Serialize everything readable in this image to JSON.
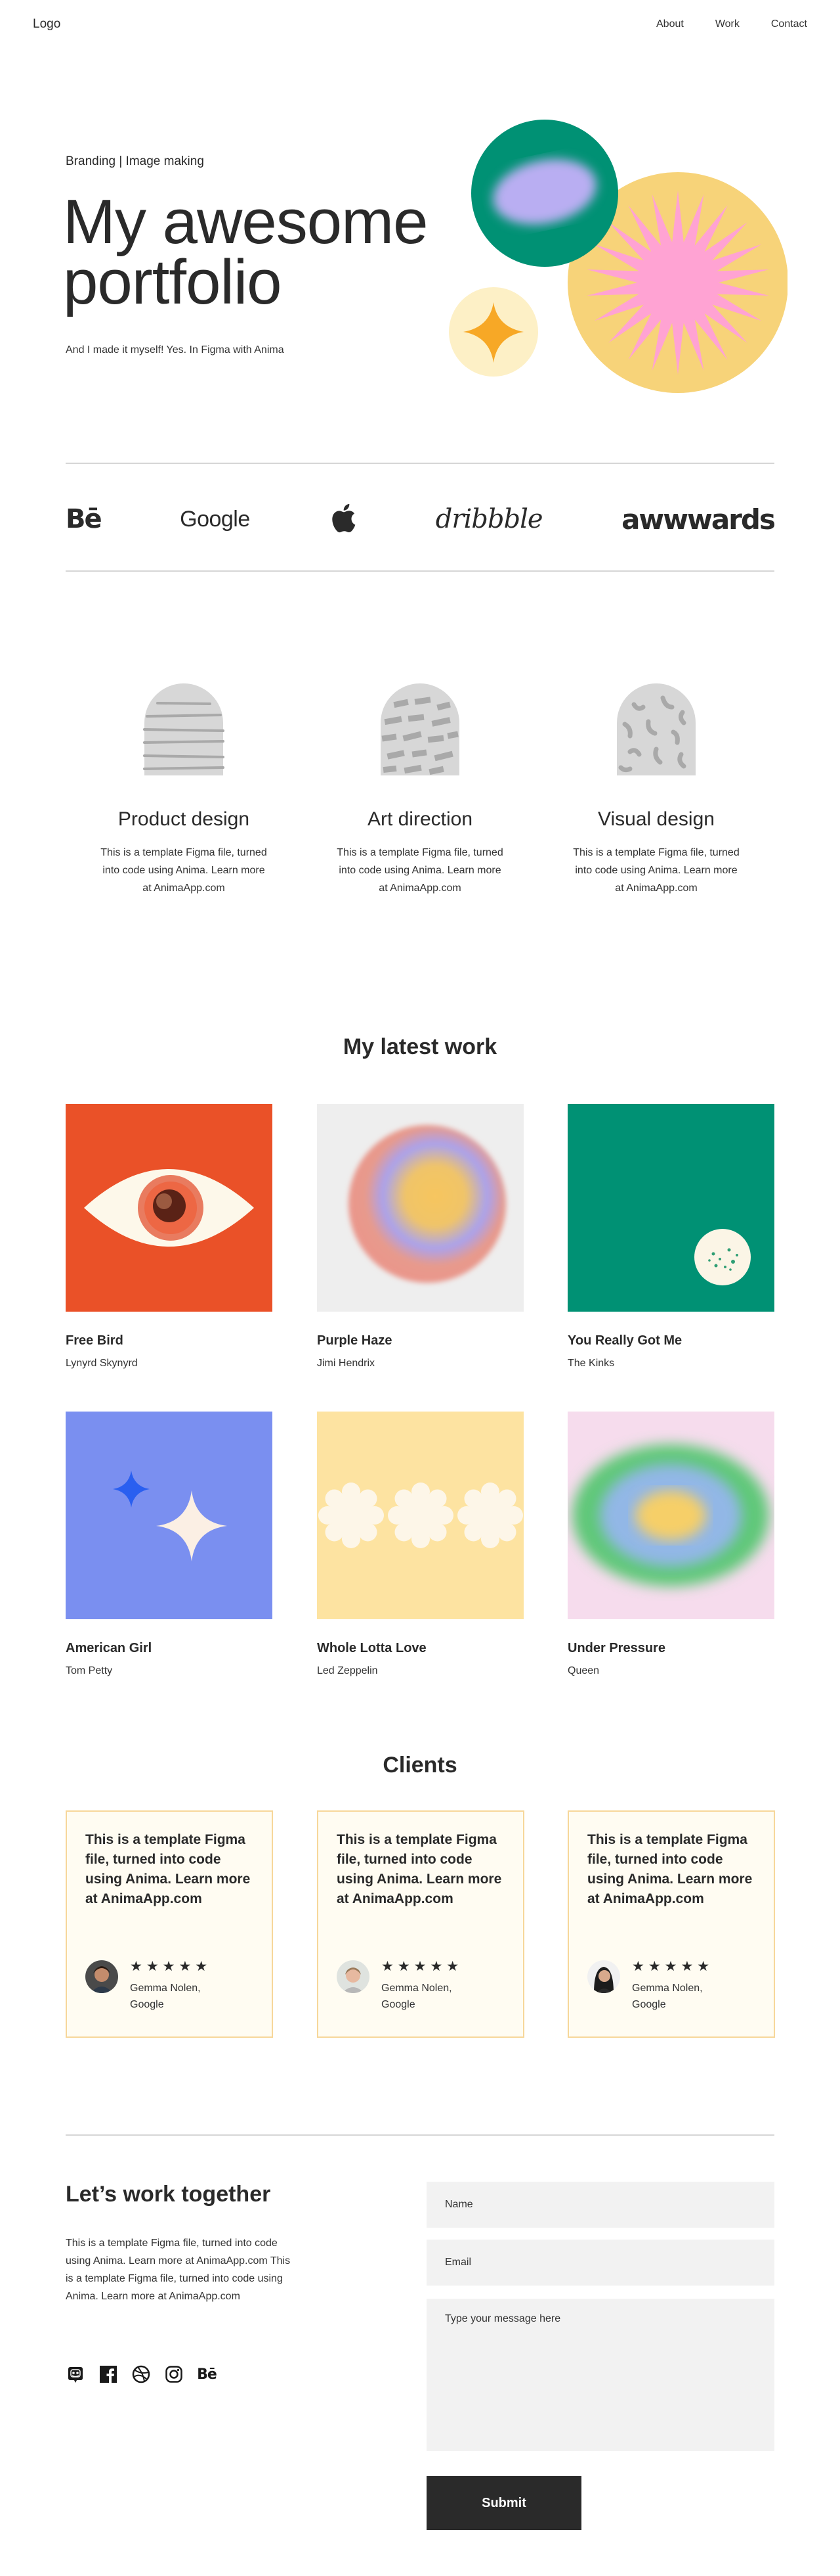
{
  "nav": {
    "logo": "Logo",
    "links": [
      "About",
      "Work",
      "Contact"
    ]
  },
  "hero": {
    "eyebrow": "Branding | Image making",
    "title_line1": "My awesome",
    "title_line2": "portfolio",
    "subtitle": "And I made it myself! Yes. In Figma with Anima"
  },
  "brands": {
    "behance": "Bē",
    "google": "Google",
    "apple": "apple-logo",
    "dribbble": "dribbble",
    "awwwards": "awwwards"
  },
  "services": [
    {
      "title": "Product design",
      "desc": "This is a template Figma file, turned into code using Anima. Learn more at AnimaApp.com"
    },
    {
      "title": "Art direction",
      "desc": "This is a template Figma file, turned into code using Anima. Learn more at AnimaApp.com"
    },
    {
      "title": "Visual design",
      "desc": "This is a template Figma file, turned into code using Anima. Learn more at AnimaApp.com"
    }
  ],
  "work": {
    "title": "My latest work",
    "items": [
      {
        "title": "Free Bird",
        "artist": "Lynyrd Skynyrd"
      },
      {
        "title": "Purple Haze",
        "artist": "Jimi Hendrix"
      },
      {
        "title": "You Really Got Me",
        "artist": "The Kinks"
      },
      {
        "title": "American Girl",
        "artist": "Tom Petty"
      },
      {
        "title": "Whole Lotta Love",
        "artist": "Led Zeppelin"
      },
      {
        "title": "Under Pressure",
        "artist": "Queen"
      }
    ]
  },
  "clients": {
    "title": "Clients",
    "items": [
      {
        "quote": "This is a template Figma file, turned into code using Anima. Learn more at AnimaApp.com",
        "stars": "★★★★★",
        "name_line1": "Gemma Nolen,",
        "name_line2": "Google"
      },
      {
        "quote": "This is a template Figma file, turned into code using Anima. Learn more at AnimaApp.com",
        "stars": "★★★★★",
        "name_line1": "Gemma Nolen,",
        "name_line2": "Google"
      },
      {
        "quote": "This is a template Figma file, turned into code using Anima. Learn more at AnimaApp.com",
        "stars": "★★★★★",
        "name_line1": "Gemma Nolen,",
        "name_line2": "Google"
      }
    ]
  },
  "contact": {
    "title": "Let’s work together",
    "desc": "This is a template Figma file, turned into code using Anima. Learn more at AnimaApp.com This is a template Figma file, turned into code using Anima. Learn more at AnimaApp.com",
    "name_placeholder": "Name",
    "email_placeholder": "Email",
    "message_placeholder": "Type your message here",
    "submit": "Submit",
    "socials": [
      "discord-icon",
      "facebook-icon",
      "dribbble-icon",
      "instagram-icon",
      "behance-icon"
    ]
  },
  "colors": {
    "text": "#2a2a2a",
    "red": "#ea5128",
    "green": "#009174",
    "yellow": "#f7d379",
    "pink": "#ffa3d3",
    "blue": "#7a8ff0",
    "card_bg": "#fffcf2",
    "card_border": "#f7d79a",
    "field_bg": "#f2f2f2"
  }
}
